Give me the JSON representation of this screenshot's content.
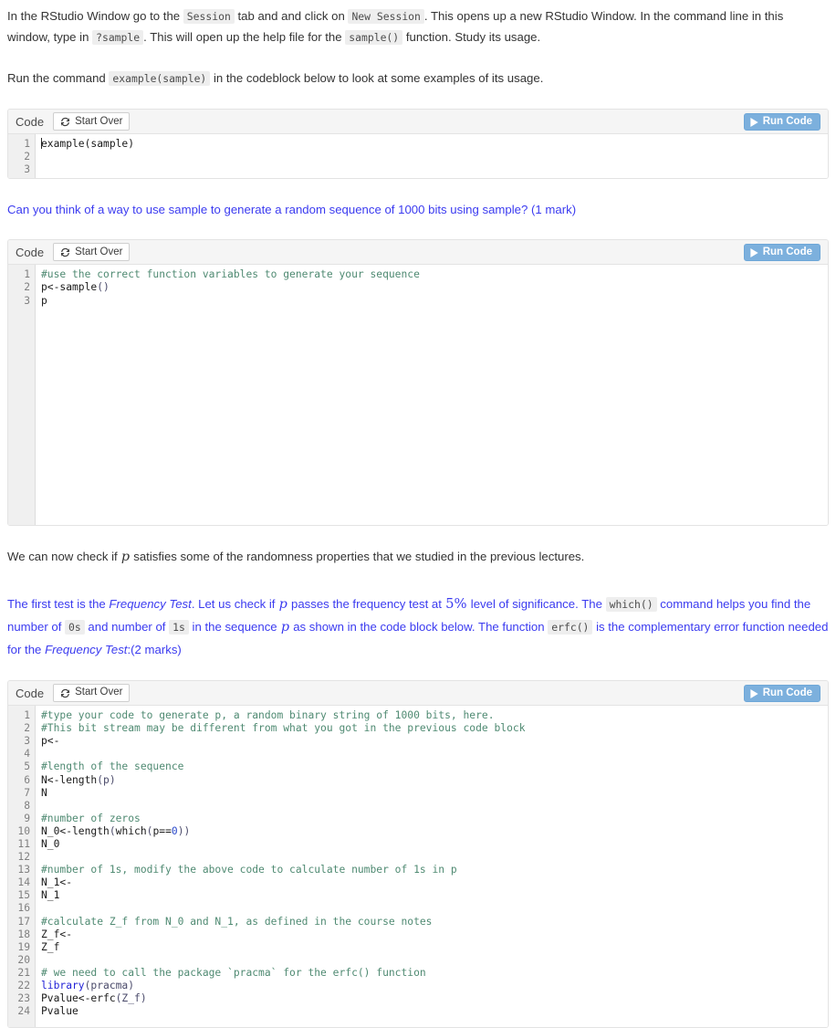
{
  "intro": {
    "para1_a": "In the RStudio Window go to the ",
    "chip_session": "Session",
    "para1_b": " tab and and click on ",
    "chip_new_session": "New Session",
    "para1_c": ". This opens up a new RStudio Window. In the command line in this window, type in ",
    "chip_qsample": "?sample",
    "para1_d": ". This will open up the help file for the ",
    "chip_sample_fn": "sample()",
    "para1_e": " function. Study its usage.",
    "para2_a": "Run the command ",
    "chip_example_sample": "example(sample)",
    "para2_b": " in the codeblock below to look at some examples of its usage."
  },
  "question1": {
    "text_a": "Can you think of a way to use sample to generate a random sequence of 1000 bits using sample? (1 mark)"
  },
  "midtext": {
    "para_a": "We can now check if ",
    "var_p": "p",
    "para_b": " satisfies some of the randomness properties that we studied in the previous lectures."
  },
  "question2": {
    "t1": "The first test is the ",
    "em1": "Frequency Test",
    "t2": ". Let us check if ",
    "var_p": "p",
    "t3": " passes the frequency test at ",
    "math_5pct": "5%",
    "t4": " level of significance. The ",
    "chip_which": "which()",
    "t5": " command helps you find the number of ",
    "chip_0s": "0s",
    "t6": " and number of ",
    "chip_1s": "1s",
    "t7": " in the sequence ",
    "var_p2": "p",
    "t8": " as shown in the code block below. The function ",
    "chip_erfc": "erfc()",
    "t9": " is the complementary error function needed for the ",
    "em2": "Frequency Test",
    "t10": ":(2 marks)"
  },
  "codeblocks": [
    {
      "title": "Code",
      "start_over_label": "Start Over",
      "run_label": "Run Code",
      "line_numbers": [
        "1",
        "2",
        "3"
      ],
      "lines": [
        [
          {
            "t": "example(sample)",
            "c": "plain",
            "caret": true
          }
        ],
        [],
        []
      ]
    },
    {
      "title": "Code",
      "start_over_label": "Start Over",
      "run_label": "Run Code",
      "line_numbers": [
        "1",
        "2",
        "3"
      ],
      "lines": [
        [
          {
            "t": "#use the correct function variables to generate your sequence",
            "c": "cmt"
          }
        ],
        [
          {
            "t": "p<-sample",
            "c": "plain"
          },
          {
            "t": "()",
            "c": "paren"
          }
        ],
        [
          {
            "t": "p",
            "c": "plain"
          }
        ]
      ]
    },
    {
      "title": "Code",
      "start_over_label": "Start Over",
      "run_label": "Run Code",
      "line_numbers": [
        "1",
        "2",
        "3",
        "4",
        "5",
        "6",
        "7",
        "8",
        "9",
        "10",
        "11",
        "12",
        "13",
        "14",
        "15",
        "16",
        "17",
        "18",
        "19",
        "20",
        "21",
        "22",
        "23",
        "24"
      ],
      "lines": [
        [
          {
            "t": "#type your code to generate p, a random binary string of 1000 bits, here.",
            "c": "cmt"
          }
        ],
        [
          {
            "t": "#This bit stream may be different from what you got in the previous code block",
            "c": "cmt"
          }
        ],
        [
          {
            "t": "p<-",
            "c": "plain"
          }
        ],
        [],
        [
          {
            "t": "#length of the sequence",
            "c": "cmt"
          }
        ],
        [
          {
            "t": "N<-length",
            "c": "plain"
          },
          {
            "t": "(p)",
            "c": "paren"
          }
        ],
        [
          {
            "t": "N",
            "c": "plain"
          }
        ],
        [],
        [
          {
            "t": "#number of zeros",
            "c": "cmt"
          }
        ],
        [
          {
            "t": "N_0<-length",
            "c": "plain"
          },
          {
            "t": "(",
            "c": "paren"
          },
          {
            "t": "which",
            "c": "plain"
          },
          {
            "t": "(",
            "c": "paren"
          },
          {
            "t": "p==",
            "c": "plain"
          },
          {
            "t": "0",
            "c": "num"
          },
          {
            "t": "))",
            "c": "paren"
          }
        ],
        [
          {
            "t": "N_0",
            "c": "plain"
          }
        ],
        [],
        [
          {
            "t": "#number of 1s, modify the above code to calculate number of 1s in p",
            "c": "cmt"
          }
        ],
        [
          {
            "t": "N_1<-",
            "c": "plain"
          }
        ],
        [
          {
            "t": "N_1",
            "c": "plain"
          }
        ],
        [],
        [
          {
            "t": "#calculate Z_f from N_0 and N_1, as defined in the course notes",
            "c": "cmt"
          }
        ],
        [
          {
            "t": "Z_f<-",
            "c": "plain"
          }
        ],
        [
          {
            "t": "Z_f",
            "c": "plain"
          }
        ],
        [],
        [
          {
            "t": "# we need to call the package `pracma` for the erfc() function",
            "c": "cmt"
          }
        ],
        [
          {
            "t": "library",
            "c": "kw"
          },
          {
            "t": "(pracma)",
            "c": "paren"
          }
        ],
        [
          {
            "t": "Pvalue<-erfc",
            "c": "plain"
          },
          {
            "t": "(Z_f)",
            "c": "paren"
          }
        ],
        [
          {
            "t": "Pvalue",
            "c": "plain"
          }
        ]
      ]
    }
  ],
  "icons": {
    "start_over": "refresh-icon",
    "run": "play-icon"
  },
  "colors": {
    "accent_blue": "#3b3bf0",
    "run_button": "#7cb0dd",
    "comment_green": "#4f8a72",
    "keyword_blue": "#1f1fd6"
  },
  "editor_heights": {
    "block0": 48,
    "block1": 285,
    "block2": 352
  }
}
